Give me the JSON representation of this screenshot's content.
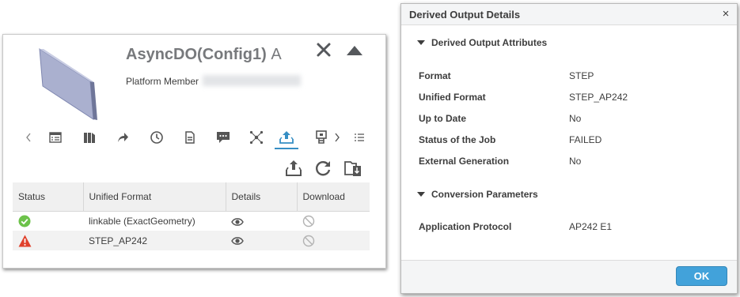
{
  "left_panel": {
    "title": "AsyncDO(Config1)",
    "revision": "A",
    "platform_member_label": "Platform Member",
    "tabs": [
      {
        "icon": "chevron-left-icon"
      },
      {
        "icon": "properties-icon"
      },
      {
        "icon": "relations-icon"
      },
      {
        "icon": "share-icon"
      },
      {
        "icon": "history-icon"
      },
      {
        "icon": "document-icon"
      },
      {
        "icon": "comment-icon"
      },
      {
        "icon": "network-icon"
      },
      {
        "icon": "derived-output-icon",
        "active": true
      },
      {
        "icon": "configuration-icon"
      },
      {
        "icon": "chevron-right-icon"
      },
      {
        "icon": "list-icon"
      }
    ],
    "table": {
      "headers": [
        "Status",
        "Unified Format",
        "Details",
        "Download"
      ],
      "rows": [
        {
          "status": "success",
          "format": "linkable (ExactGeometry)"
        },
        {
          "status": "failed",
          "format": "STEP_AP242"
        }
      ]
    }
  },
  "dialog": {
    "title": "Derived Output Details",
    "close_glyph": "×",
    "sections": [
      {
        "heading": "Derived Output Attributes",
        "attributes": [
          {
            "label": "Format",
            "value": "STEP"
          },
          {
            "label": "Unified Format",
            "value": "STEP_AP242"
          },
          {
            "label": "Up to Date",
            "value": "No"
          },
          {
            "label": "Status of the Job",
            "value": "FAILED"
          },
          {
            "label": "External Generation",
            "value": "No"
          }
        ]
      },
      {
        "heading": "Conversion Parameters",
        "attributes": [
          {
            "label": "Application Protocol",
            "value": "AP242 E1"
          }
        ]
      }
    ],
    "ok_label": "OK"
  },
  "colors": {
    "accent": "#368ec4",
    "ok_button": "#42a2da",
    "success": "#6cc24a",
    "failed": "#e0412c"
  }
}
